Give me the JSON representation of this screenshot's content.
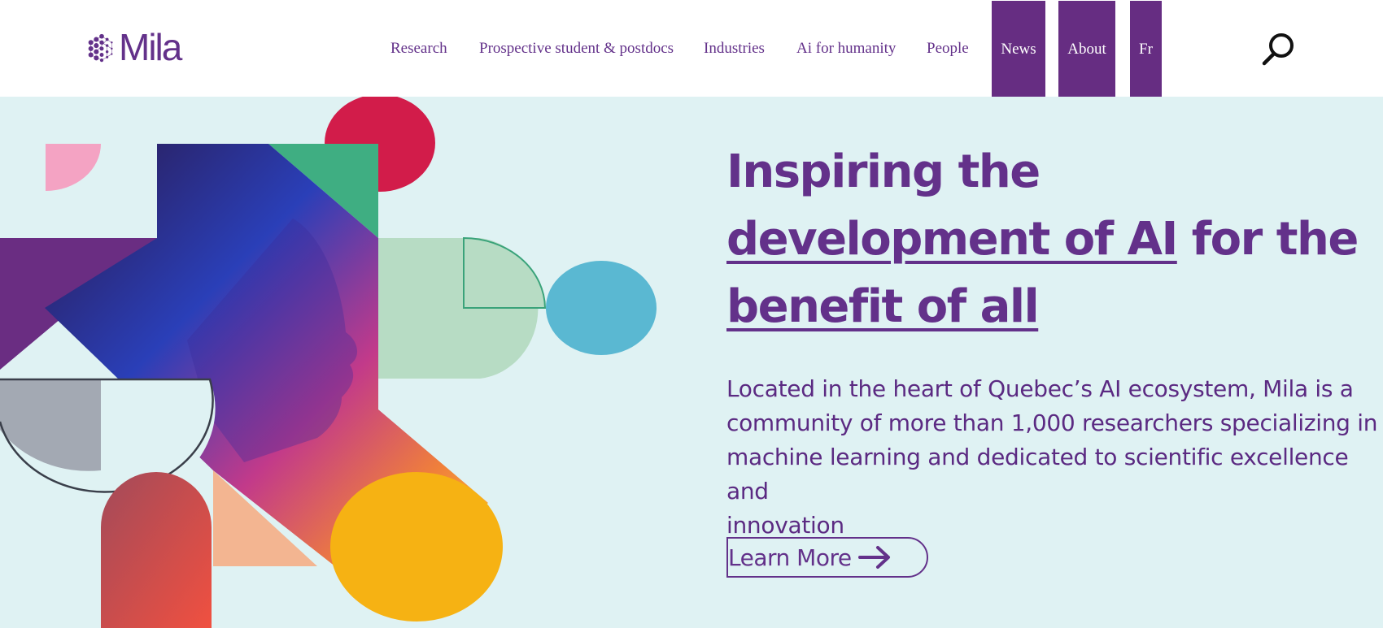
{
  "brand": {
    "name": "Mila",
    "logo_icon": "mila-dots-icon",
    "color": "#63318a"
  },
  "nav": {
    "items": [
      {
        "label": "Research"
      },
      {
        "label": "Prospective student & postdocs"
      },
      {
        "label": "Industries"
      },
      {
        "label": "Ai for humanity"
      },
      {
        "label": "People"
      }
    ],
    "highlighted": [
      {
        "label": "News"
      },
      {
        "label": "About"
      },
      {
        "label": "Fr"
      }
    ],
    "highlight_color": "#662d82",
    "search_icon": "search-icon"
  },
  "hero": {
    "background": "#dff2f3",
    "headline": {
      "line1": "Inspiring the",
      "link1": "development of AI",
      "mid": " for the",
      "link2": "benefit of all"
    },
    "description": "Located in the heart of Quebec’s AI ecosystem, Mila is a\ncommunity of more than 1,000 researchers specializing in\nmachine learning and dedicated to scientific excellence and\ninnovation",
    "cta": {
      "label": "Learn More",
      "icon": "arrow-right-icon"
    },
    "image": "collage-portrait-illustration"
  }
}
